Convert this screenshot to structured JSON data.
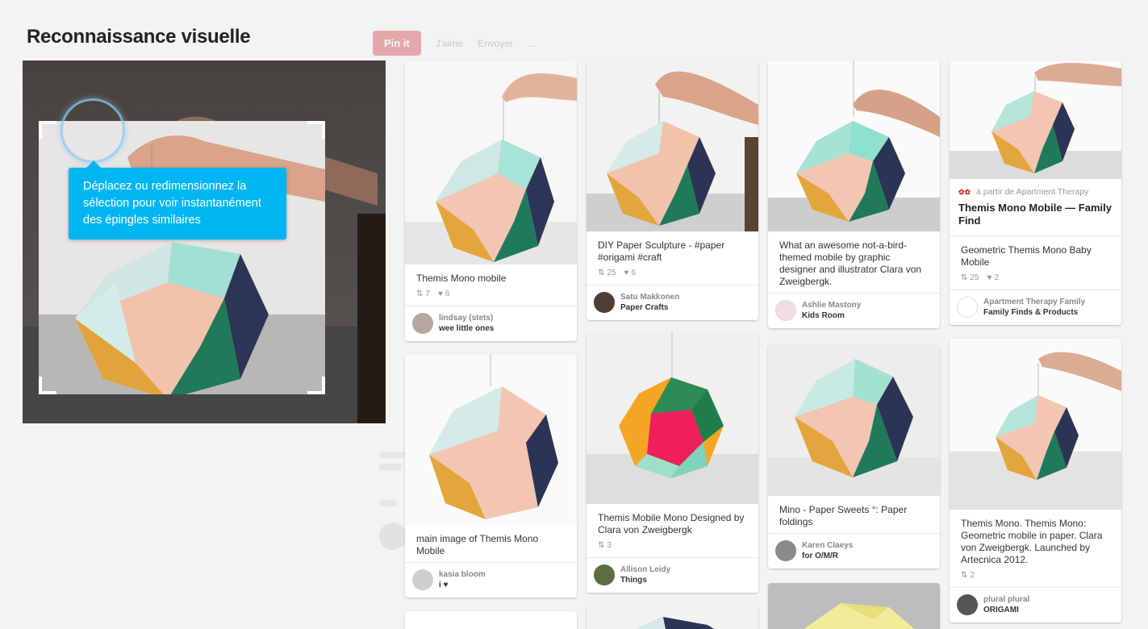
{
  "page": {
    "title": "Reconnaissance visuelle"
  },
  "background": {
    "pin_label": "Pin it",
    "like_label": "J'aime",
    "share_label": "Envoyer",
    "more_label": "..."
  },
  "tooltip": {
    "text": "Déplacez ou redimensionnez la sélection pour voir instantanément des épingles similaires"
  },
  "pins": [
    {
      "description": "Themis Mono mobile",
      "repins": "7",
      "likes": "6",
      "user": "lindsay (stets)",
      "board": "wee little ones"
    },
    {
      "description": "main image of Themis Mono Mobile",
      "user": "kasia bloom",
      "board": "i ♥"
    },
    {
      "description": "DIY Paper Sculpture - #paper #origami #craft",
      "repins": "25",
      "likes": "6",
      "user": "Satu Makkonen",
      "board": "Paper Crafts"
    },
    {
      "description": "Themis Mobile Mono Designed by Clara von Zweigbergk",
      "repins": "3",
      "user": "Allison Leidy",
      "board": "Things"
    },
    {
      "description": "What an awesome not-a-bird-themed mobile by graphic designer and illustrator Clara von Zweigbergk.",
      "user": "Ashlie Mastony",
      "board": "Kids Room"
    },
    {
      "description": "Mino - Paper Sweets °: Paper foldings",
      "user": "Karen Claeys",
      "board": "for O/M/R"
    },
    {
      "source": "à partir de Apartment Therapy",
      "title": "Themis Mono Mobile — Family Find",
      "description": "Geometric Themis Mono Baby Mobile",
      "repins": "25",
      "likes": "2",
      "user": "Apartment Therapy Family",
      "board": "Family Finds & Products"
    },
    {
      "description": "Themis Mono. Themis Mono: Geometric mobile in paper. Clara von Zweigbergk. Launched by Artecnica 2012.",
      "repins": "2",
      "user": "plural plural",
      "board": "ORIGAMI"
    }
  ],
  "icons": {
    "repin": "repin-icon",
    "like": "heart-icon"
  },
  "colors": {
    "accent": "#00b6f2",
    "pin_red": "#cb2027",
    "background": "#f3f3f3"
  }
}
